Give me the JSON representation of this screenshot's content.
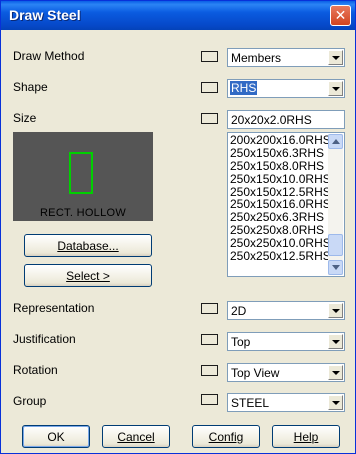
{
  "window": {
    "title": "Draw Steel",
    "close_glyph": "✕"
  },
  "fields": {
    "draw_method": {
      "label": "Draw Method",
      "value": "Members"
    },
    "shape": {
      "label": "Shape",
      "value": "RHS"
    },
    "size": {
      "label": "Size",
      "value": "20x20x2.0RHS"
    },
    "representation": {
      "label": "Representation",
      "value": "2D"
    },
    "justification": {
      "label": "Justification",
      "value": "Top"
    },
    "rotation": {
      "label": "Rotation",
      "value": "Top View"
    },
    "group": {
      "label": "Group",
      "value": "STEEL"
    }
  },
  "size_list": [
    "200x200x16.0RHS",
    "250x150x6.3RHS",
    "250x150x8.0RHS",
    "250x150x10.0RHS",
    "250x150x12.5RHS",
    "250x150x16.0RHS",
    "250x250x6.3RHS",
    "250x250x8.0RHS",
    "250x250x10.0RHS",
    "250x250x12.5RHS"
  ],
  "preview": {
    "caption": "RECT. HOLLOW",
    "shape_color": "#00d000"
  },
  "buttons": {
    "database": "Database...",
    "select": "Select >",
    "ok": "OK",
    "cancel": "Cancel",
    "config": "Config",
    "help": "Help"
  },
  "colors": {
    "title_bar": "#0a5be0",
    "selection": "#316ac5",
    "dialog_bg": "#ece9d8"
  }
}
